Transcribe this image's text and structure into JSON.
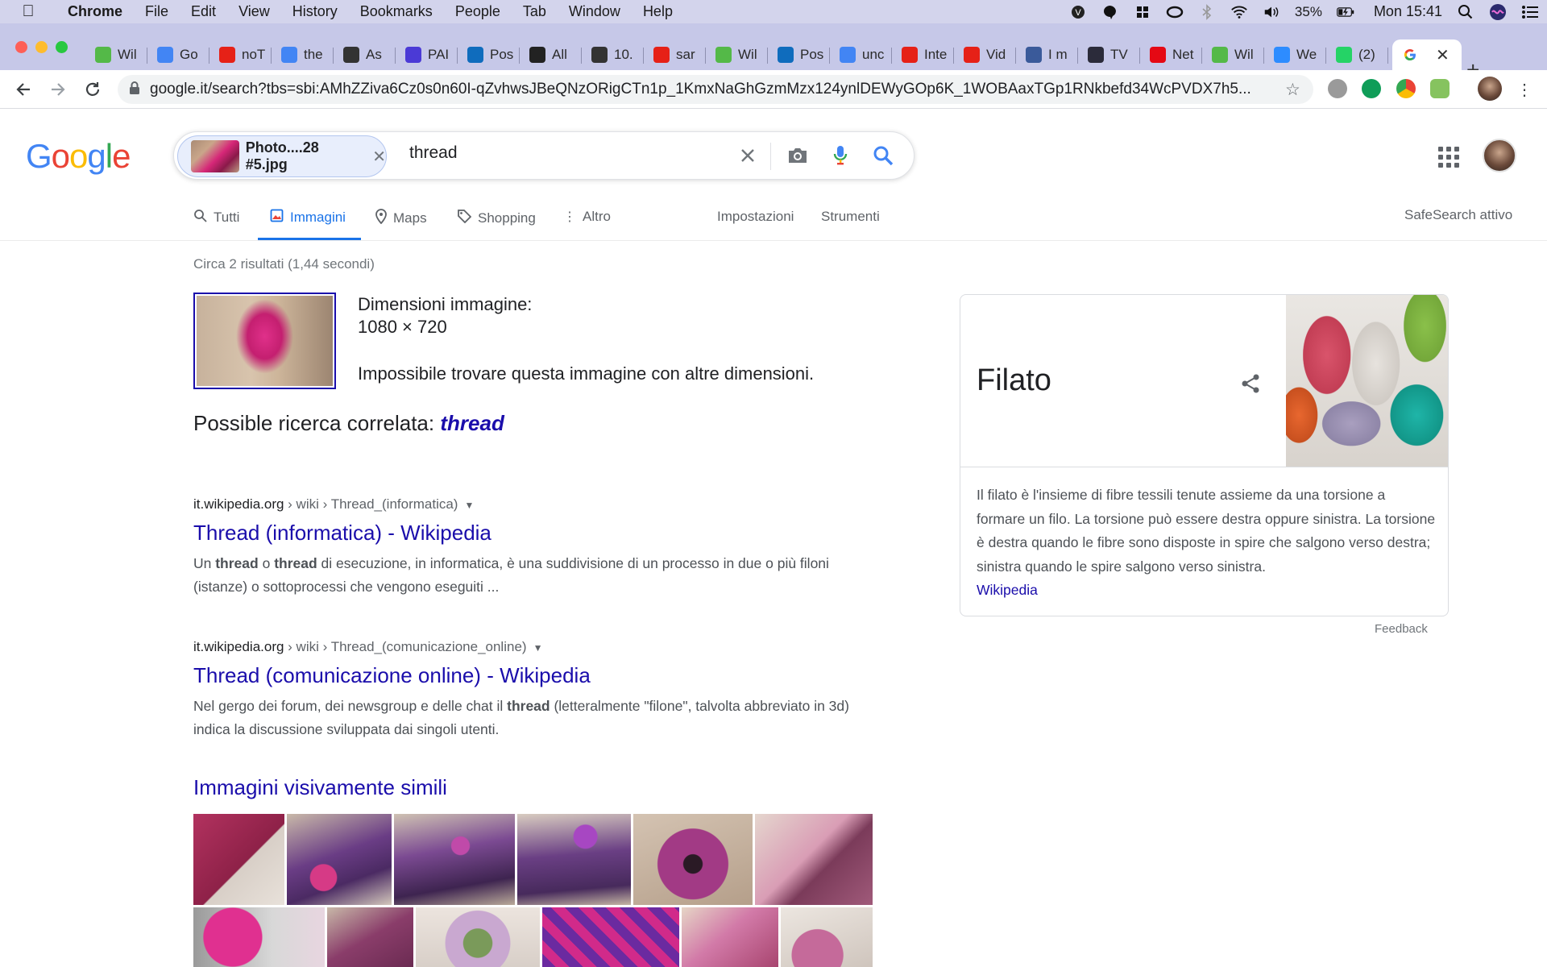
{
  "menubar": {
    "app": "Chrome",
    "items": [
      "File",
      "Edit",
      "View",
      "History",
      "Bookmarks",
      "People",
      "Tab",
      "Window",
      "Help"
    ],
    "battery": "35%",
    "clock": "Mon 15:41"
  },
  "tabs": [
    {
      "label": "Wil",
      "icon": "utorrent-icon",
      "color": "#54b948"
    },
    {
      "label": "Go",
      "icon": "google-icon",
      "color": "#4285f4"
    },
    {
      "label": "noT",
      "icon": "youtube-icon",
      "color": "#e62117"
    },
    {
      "label": "the",
      "icon": "docs-icon",
      "color": "#4285f4"
    },
    {
      "label": "As",
      "icon": "wikipedia-icon",
      "color": "#333333"
    },
    {
      "label": "PAI",
      "icon": "m-icon",
      "color": "#4b3ad6"
    },
    {
      "label": "Pos",
      "icon": "outlook-icon",
      "color": "#0f6cbd"
    },
    {
      "label": "All",
      "icon": "v-icon",
      "color": "#222222"
    },
    {
      "label": "10.",
      "icon": "globe-icon",
      "color": "#333333"
    },
    {
      "label": "sar",
      "icon": "youtube-icon",
      "color": "#e62117"
    },
    {
      "label": "Wil",
      "icon": "utorrent-icon",
      "color": "#54b948"
    },
    {
      "label": "Pos",
      "icon": "outlook-icon",
      "color": "#0f6cbd"
    },
    {
      "label": "unc",
      "icon": "google-icon",
      "color": "#4285f4"
    },
    {
      "label": "Inte",
      "icon": "youtube-icon",
      "color": "#e62117"
    },
    {
      "label": "Vid",
      "icon": "youtube-icon",
      "color": "#e62117"
    },
    {
      "label": "I m",
      "icon": "image-icon",
      "color": "#3a5a9a"
    },
    {
      "label": "TV",
      "icon": "premiere-icon",
      "color": "#2b2b3a"
    },
    {
      "label": "Net",
      "icon": "netflix-icon",
      "color": "#e50914"
    },
    {
      "label": "Wil",
      "icon": "utorrent-icon",
      "color": "#54b948"
    },
    {
      "label": "We",
      "icon": "zoom-icon",
      "color": "#2d8cff"
    },
    {
      "label": "(2)",
      "icon": "whatsapp-icon",
      "color": "#25d366"
    }
  ],
  "active_tab": {
    "icon": "google-icon"
  },
  "omnibox": {
    "url": "google.it/search?tbs=sbi:AMhZZiva6Cz0s0n60I-qZvhwsJBeQNzORigCTn1p_1KmxNaGhGzmMzx124ynlDEWyGOp6K_1WOBAaxTGp1RNkbefd34WcPVDX7h5..."
  },
  "google": {
    "logo": "Google",
    "chip_label": "Photo....28 #5.jpg",
    "query": "thread"
  },
  "nav": {
    "tutti": "Tutti",
    "immagini": "Immagini",
    "maps": "Maps",
    "shopping": "Shopping",
    "altro": "Altro",
    "impostazioni": "Impostazioni",
    "strumenti": "Strumenti",
    "safesearch": "SafeSearch attivo"
  },
  "results": {
    "stats": "Circa 2 risultati (1,44 secondi)",
    "dimensions_label": "Dimensioni immagine:",
    "dimensions_value": "1080 × 720",
    "no_other_sizes": "Impossibile trovare questa immagine con altre dimensioni.",
    "related_prefix": "Possible ricerca correlata:",
    "related_term": "thread",
    "items": [
      {
        "domain": "it.wikipedia.org",
        "path": " › wiki › Thread_(informatica)",
        "title": "Thread (informatica) - Wikipedia",
        "snippet_html": "Un <b>thread</b> o <b>thread</b> di esecuzione, in informatica, è una suddivisione di un processo in due o più filoni (istanze) o sottoprocessi che vengono eseguiti ..."
      },
      {
        "domain": "it.wikipedia.org",
        "path": " › wiki › Thread_(comunicazione_online)",
        "title": "Thread (comunicazione online) - Wikipedia",
        "snippet_html": "Nel gergo dei forum, dei newsgroup e delle chat il <b>thread</b> (letteralmente \"filone\", talvolta abbreviato in 3d) indica la discussione sviluppata dai singoli utenti."
      }
    ],
    "similar_heading": "Immagini visivamente simili"
  },
  "knowledge_panel": {
    "title": "Filato",
    "description": "Il filato è l'insieme di fibre tessili tenute assieme da una torsione a formare un filo. La torsione può essere destra oppure sinistra. La torsione è destra quando le fibre sono disposte in spire che salgono verso destra; sinistra quando le spire salgono verso sinistra.",
    "source": "Wikipedia",
    "feedback": "Feedback"
  },
  "colors": {
    "link": "#1a0dab",
    "accent": "#1a73e8",
    "menubar_bg": "#d3d4ec",
    "tabstrip_bg": "#c6c8e8"
  }
}
